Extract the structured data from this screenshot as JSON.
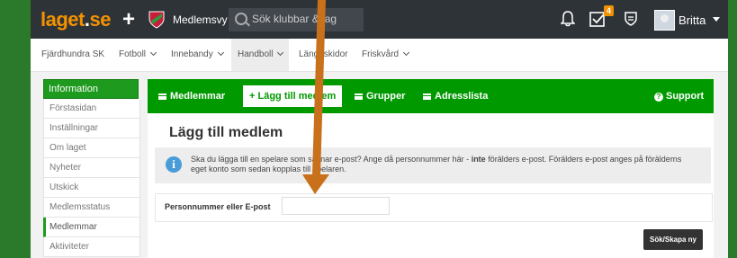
{
  "topbar": {
    "logo_main": "laget",
    "logo_dot": ".",
    "logo_tld": "se",
    "plus": "+",
    "view_label": "Medlemsvy",
    "search_placeholder": "Sök klubbar & lag",
    "notification_count": "4",
    "username": "Britta"
  },
  "subnav": {
    "items": [
      {
        "label": "Fjärdhundra SK"
      },
      {
        "label": "Fotboll"
      },
      {
        "label": "Innebandy"
      },
      {
        "label": "Handboll"
      },
      {
        "label": "Längdskidor"
      },
      {
        "label": "Friskvård"
      }
    ]
  },
  "sidebar": {
    "header": "Information",
    "items": [
      {
        "label": "Förstasidan"
      },
      {
        "label": "Inställningar"
      },
      {
        "label": "Om laget"
      },
      {
        "label": "Nyheter"
      },
      {
        "label": "Utskick"
      },
      {
        "label": "Medlemsstatus"
      },
      {
        "label": "Medlemmar"
      },
      {
        "label": "Aktiviteter"
      }
    ]
  },
  "main": {
    "tabs": {
      "members": "Medlemmar",
      "add_member": "Lägg till medlem",
      "groups": "Grupper",
      "address_list": "Adresslista",
      "support": "Support"
    },
    "title": "Lägg till medlem",
    "info_before": "Ska du lägga till en spelare som saknar e-post? Ange då personnummer här - ",
    "info_bold": "inte",
    "info_after": " förälders e-post. Förälders e-post anges på förälderns eget konto som sedan kopplas till spelaren.",
    "field_label": "Personnummer eller E-post",
    "field_value": "",
    "submit_label": "Sök/Skapa ny"
  },
  "colors": {
    "accent_green": "#009900",
    "topbar": "#2e3338",
    "logo_orange": "#f39200",
    "annotation_arrow": "#c8701a"
  },
  "icons": [
    "plus-icon",
    "club-shield-icon",
    "search-icon",
    "bell-icon",
    "tasks-icon",
    "shield-icon",
    "avatar",
    "chevron-down-icon",
    "menu-icon",
    "plus-icon",
    "question-icon",
    "info-icon"
  ]
}
